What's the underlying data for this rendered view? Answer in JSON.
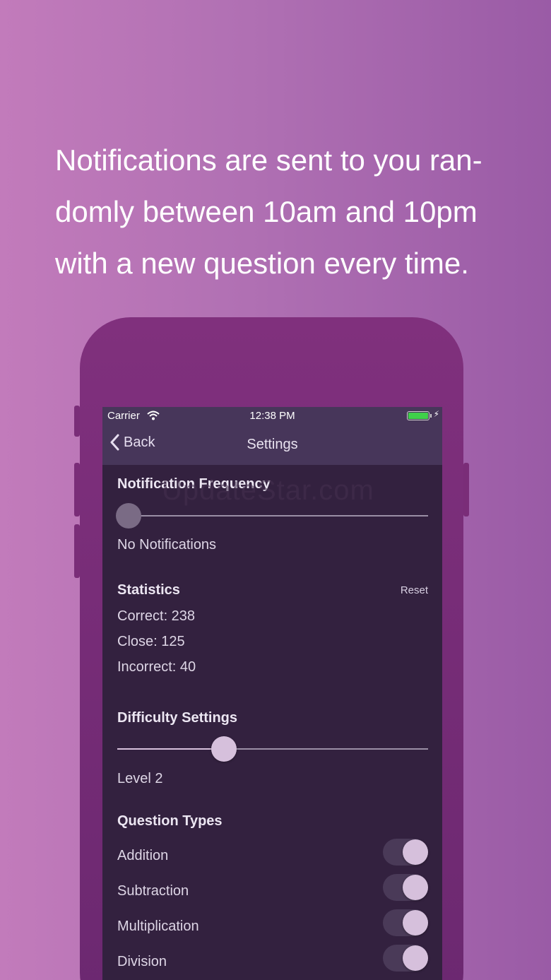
{
  "caption": {
    "line1": "Notifications are sent to you ran-",
    "line2": "domly between 10am and 10pm",
    "line3": "with a new question every time."
  },
  "status_bar": {
    "carrier": "Carrier",
    "time": "12:38 PM",
    "battery_level": 1.0
  },
  "nav": {
    "back_label": "Back",
    "title": "Settings"
  },
  "notification_frequency": {
    "title": "Notification Frequency",
    "slider_value": 0,
    "value_label": "No Notifications"
  },
  "statistics": {
    "title": "Statistics",
    "reset_label": "Reset",
    "correct": "Correct: 238",
    "close": "Close: 125",
    "incorrect": "Incorrect: 40"
  },
  "difficulty": {
    "title": "Difficulty Settings",
    "slider_value": 0.34,
    "value_label": "Level 2"
  },
  "question_types": {
    "title": "Question Types",
    "items": [
      {
        "label": "Addition",
        "enabled": true
      },
      {
        "label": "Subtraction",
        "enabled": true
      },
      {
        "label": "Multiplication",
        "enabled": true
      },
      {
        "label": "Division",
        "enabled": true
      }
    ]
  },
  "watermark": "UpdateStar.com",
  "colors": {
    "accent": "#d6c0dc",
    "screen_bg": "#33213f",
    "navbar_bg": "#47365a"
  }
}
